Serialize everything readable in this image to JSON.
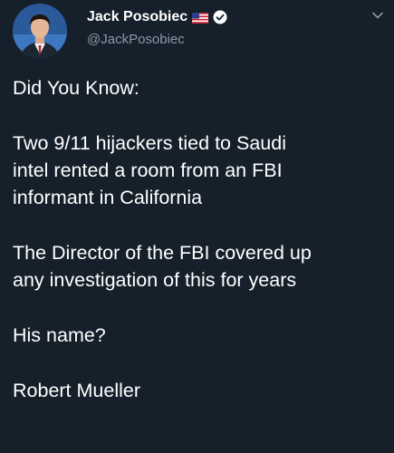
{
  "author": {
    "display_name": "Jack Posobiec",
    "handle": "@JackPosobiec",
    "flag_icon": "us-flag-icon",
    "verified_icon": "verified-badge-icon"
  },
  "menu_icon": "chevron-down-icon",
  "tweet": {
    "paragraphs": [
      "Did You Know:",
      "Two 9/11 hijackers tied to Saudi\nintel rented a room from an FBI\ninformant in California",
      "The Director of the FBI covered up\nany investigation of this for years",
      "His name?",
      "Robert Mueller"
    ]
  },
  "colors": {
    "background": "#15202b",
    "text": "#ffffff",
    "secondary_text": "#8899a6"
  }
}
